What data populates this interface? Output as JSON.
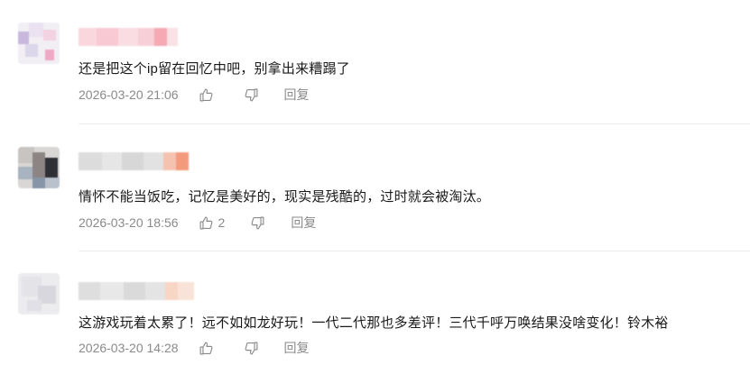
{
  "comments": [
    {
      "text": "还是把这个ip留在回忆中吧，别拿出来糟蹋了",
      "time": "2026-03-20 21:06",
      "likes": "",
      "reply_label": "回复"
    },
    {
      "text": "情怀不能当饭吃，记忆是美好的，现实是残酷的，过时就会被淘汰。",
      "time": "2026-03-20 18:56",
      "likes": "2",
      "reply_label": "回复"
    },
    {
      "text": "这游戏玩着太累了！远不如如龙好玩！一代二代那也多差评！三代千呼万唤结果没啥变化！铃木裕",
      "time": "2026-03-20 14:28",
      "likes": "",
      "reply_label": "回复"
    }
  ],
  "colors": {
    "meta_text": "#8a8a8a",
    "divider": "#ececec",
    "username_blur_pink": "#f6c3cc",
    "username_blur_orange": "#f4a98c"
  },
  "icons": [
    "like-icon",
    "dislike-icon"
  ]
}
